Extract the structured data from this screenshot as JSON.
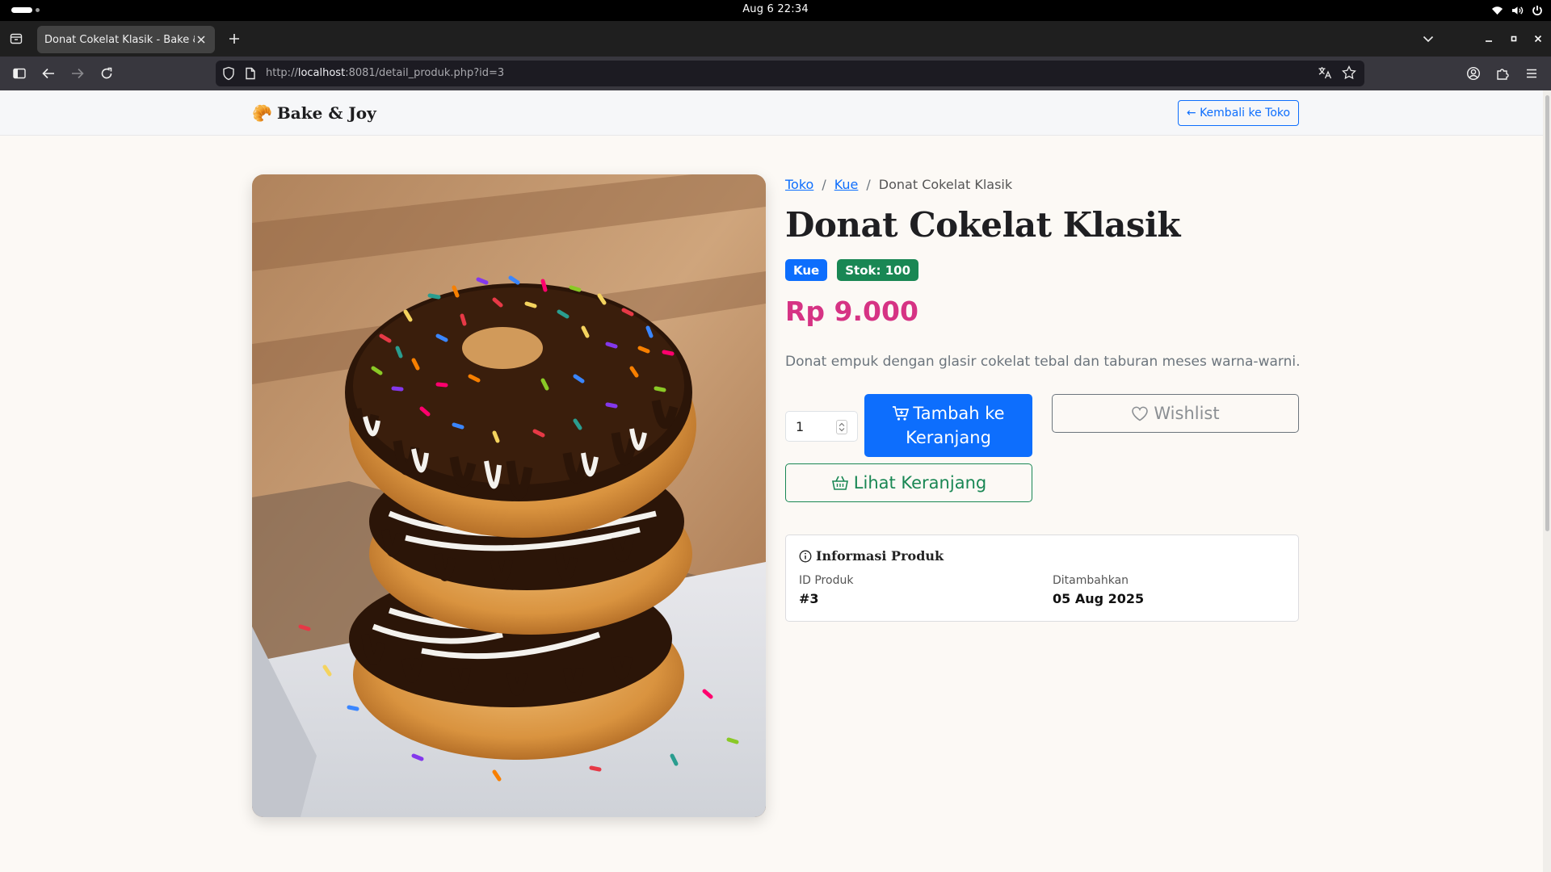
{
  "system": {
    "clock": "Aug 6  22:34"
  },
  "browser": {
    "tab_title": "Donat Cokelat Klasik - Bake & Joy",
    "url_prefix": "http://",
    "url_host": "localhost",
    "url_rest": ":8081/detail_produk.php?id=3"
  },
  "site": {
    "brand_icon": "🥐",
    "brand_name": "Bake & Joy",
    "back_button": "← Kembali ke Toko"
  },
  "breadcrumb": {
    "items": [
      "Toko",
      "Kue"
    ],
    "current": "Donat Cokelat Klasik",
    "separator": "/"
  },
  "product": {
    "title": "Donat Cokelat Klasik",
    "category_badge": "Kue",
    "stock_badge": "Stok: 100",
    "price": "Rp 9.000",
    "description": "Donat empuk dengan glasir cokelat tebal dan taburan meses warna-warni.",
    "image_alt": "stacked chocolate sprinkle donuts",
    "quantity": "1"
  },
  "actions": {
    "add_to_cart_line1": "Tambah ke",
    "add_to_cart_line2": "Keranjang",
    "wishlist": "Wishlist",
    "view_cart": "Lihat Keranjang"
  },
  "info": {
    "heading": "Informasi Produk",
    "id_label": "ID Produk",
    "id_value": "#3",
    "added_label": "Ditambahkan",
    "added_value": "05 Aug 2025"
  },
  "colors": {
    "primary": "#0d6efd",
    "success": "#198754",
    "price": "#d63384"
  }
}
